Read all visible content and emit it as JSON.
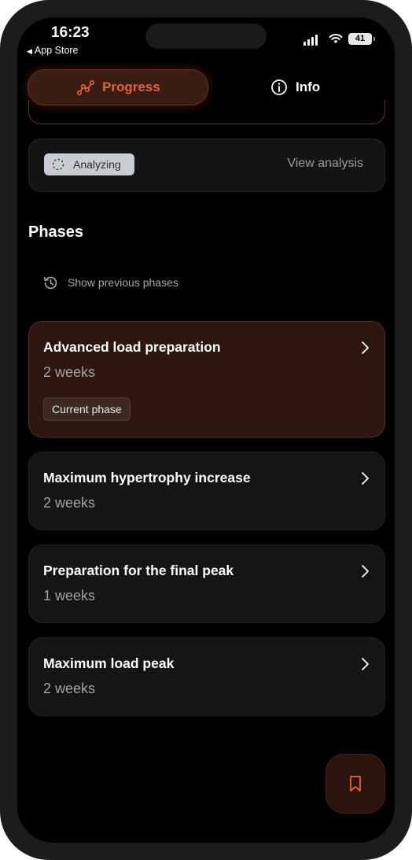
{
  "status_bar": {
    "time": "16:23",
    "back_label": "App Store",
    "battery": "41"
  },
  "tabs": {
    "progress": {
      "label": "Progress",
      "icon": "trend-chart-icon",
      "active": true,
      "accent": "#e8623a"
    },
    "info": {
      "label": "Info",
      "icon": "info-icon",
      "active": false
    }
  },
  "analysis": {
    "status_label": "Analyzing",
    "status_icon": "spinner-icon",
    "link_label": "View analysis"
  },
  "phases": {
    "title": "Phases",
    "show_previous_label": "Show previous phases",
    "items": [
      {
        "title": "Advanced load preparation",
        "duration": "2 weeks",
        "badge": "Current phase",
        "current": true
      },
      {
        "title": "Maximum hypertrophy increase",
        "duration": "2 weeks"
      },
      {
        "title": "Preparation for the final peak",
        "duration": "1 weeks"
      },
      {
        "title": "Maximum load peak",
        "duration": "2 weeks"
      }
    ]
  },
  "fab": {
    "icon": "bookmark-icon"
  }
}
